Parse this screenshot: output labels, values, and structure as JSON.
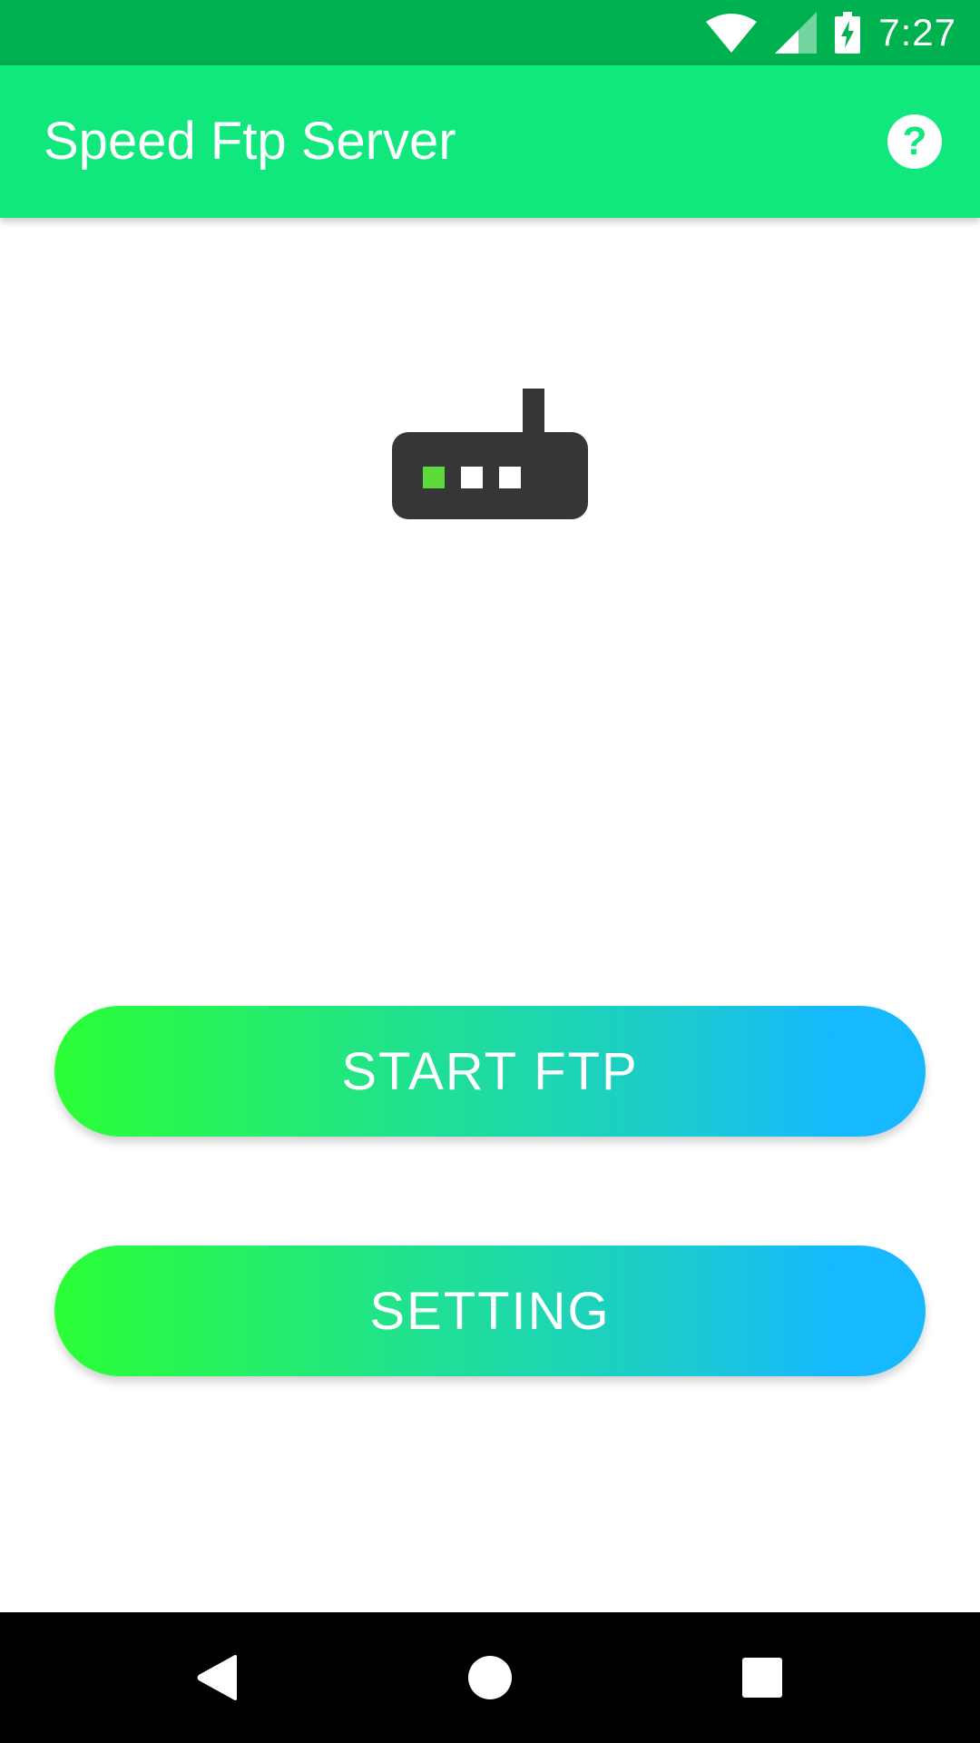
{
  "status_bar": {
    "time": "7:27",
    "icons": [
      "wifi-icon",
      "cell-signal-icon",
      "battery-charging-icon"
    ]
  },
  "app_bar": {
    "title": "Speed Ftp Server",
    "help_icon": "help-circle-icon",
    "help_glyph": "?"
  },
  "main": {
    "router_icon": "router-icon",
    "start_button_label": "START FTP",
    "setting_button_label": "SETTING"
  },
  "nav_bar": {
    "back_icon": "back-icon",
    "home_icon": "home-icon",
    "recents_icon": "recents-icon"
  },
  "colors": {
    "status_bar": "#00b150",
    "app_bar": "#10e87e",
    "gradient_start": "#2cff35",
    "gradient_end": "#16b8ff",
    "router_body": "#353734",
    "router_led_active": "#5ddb3c"
  }
}
